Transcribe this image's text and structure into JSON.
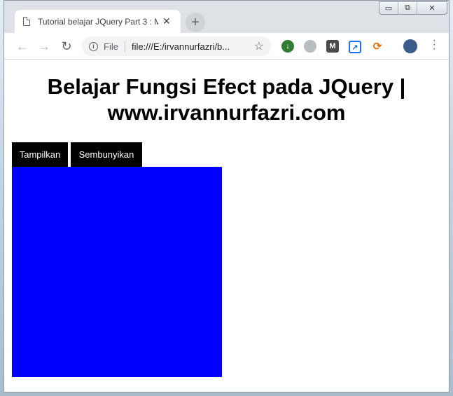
{
  "browser": {
    "tab_title": "Tutorial belajar JQuery Part 3 : M",
    "tab_close": "✕",
    "new_tab": "+",
    "address_scheme_label": "File",
    "url": "file:///E:/irvannurfazri/b...",
    "window_controls": {
      "minimize": "▭",
      "restore": "⧉",
      "close": "✕"
    }
  },
  "page": {
    "heading_line1": "Belajar Fungsi Efect pada JQuery |",
    "heading_line2": "www.irvannurfazri.com",
    "buttons": {
      "show": "Tampilkan",
      "hide": "Sembunyikan"
    },
    "box_color": "#0000ff"
  }
}
